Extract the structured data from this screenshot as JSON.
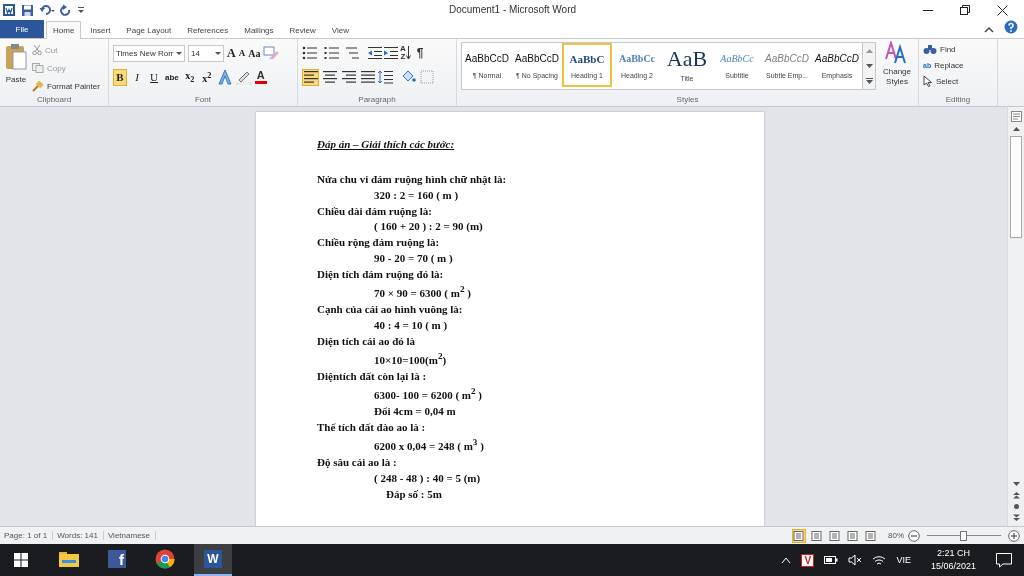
{
  "window": {
    "title": "Document1 - Microsoft Word"
  },
  "tabs": [
    {
      "label": "File",
      "kind": "file",
      "selected": false
    },
    {
      "label": "Home",
      "kind": "tab",
      "selected": true
    },
    {
      "label": "Insert",
      "kind": "tab",
      "selected": false
    },
    {
      "label": "Page Layout",
      "kind": "tab",
      "selected": false
    },
    {
      "label": "References",
      "kind": "tab",
      "selected": false
    },
    {
      "label": "Mailings",
      "kind": "tab",
      "selected": false
    },
    {
      "label": "Review",
      "kind": "tab",
      "selected": false
    },
    {
      "label": "View",
      "kind": "tab",
      "selected": false
    }
  ],
  "clipboard": {
    "paste": "Paste",
    "cut": "Cut",
    "copy": "Copy",
    "format_painter": "Format Painter",
    "group": "Clipboard"
  },
  "font": {
    "name": "Times New Rorr",
    "size": "14",
    "grow": "A",
    "shrink": "A",
    "case": "Aa",
    "group": "Font",
    "format_buttons": [
      {
        "label": "B",
        "kind": "bold",
        "selected": true
      },
      {
        "label": "I",
        "kind": "italic",
        "selected": false
      },
      {
        "label": "U",
        "kind": "underline",
        "selected": false
      },
      {
        "label": "abe",
        "kind": "strike",
        "selected": false
      },
      {
        "label": "x$_{2}$",
        "kind": "sub",
        "selected": false
      },
      {
        "label": "x$^{2}$",
        "kind": "sup",
        "selected": false
      }
    ],
    "color_letter": "A"
  },
  "paragraph": {
    "group": "Paragraph",
    "pilcrow": "¶",
    "sort_a": "A",
    "sort_z": "Z",
    "alignment": [
      {
        "selected": true
      },
      {
        "selected": false
      },
      {
        "selected": false
      },
      {
        "selected": false
      }
    ]
  },
  "styles": {
    "group": "Styles",
    "change": "Change Styles",
    "items": [
      {
        "preview": "AaBbCcD",
        "label": "¶ Normal",
        "kind": "normal",
        "selected": false
      },
      {
        "preview": "AaBbCcD",
        "label": "¶ No Spacing",
        "kind": "normal",
        "selected": false
      },
      {
        "preview": "AaBbC",
        "label": "Heading 1",
        "kind": "heading1",
        "selected": true
      },
      {
        "preview": "AaBbCc",
        "label": "Heading 2",
        "kind": "heading2",
        "selected": false
      },
      {
        "preview": "AaB",
        "label": "Title",
        "kind": "title",
        "selected": false
      },
      {
        "preview": "AaBbCc",
        "label": "Subtitle",
        "kind": "subtitle",
        "selected": false
      },
      {
        "preview": "AaBbCcD",
        "label": "Subtle Emp...",
        "kind": "subtle",
        "selected": false
      },
      {
        "preview": "AaBbCcD",
        "label": "Emphasis",
        "kind": "emphasis",
        "selected": false
      }
    ]
  },
  "editing": {
    "find": "Find",
    "replace": "Replace",
    "select": "Select",
    "group": "Editing",
    "replace_mark": "ab"
  },
  "document": {
    "heading": "Đáp án – Giải thích các bước:",
    "lines": [
      {
        "text": "Nửa chu vi đám ruộng hình chữ nhật là:",
        "kind": "label"
      },
      {
        "text": "320 : 2 = 160 ( m )",
        "kind": "formula"
      },
      {
        "text": "Chiều dài đám ruộng là:",
        "kind": "label"
      },
      {
        "text": "( 160 + 20 ) : 2 = 90 (m)",
        "kind": "formula"
      },
      {
        "text": "Chiều rộng đám ruộng là:",
        "kind": "label"
      },
      {
        "text": "90 - 20 = 70 ( m )",
        "kind": "formula"
      },
      {
        "text": "Diện tích đám ruộng đó là:",
        "kind": "label"
      },
      {
        "text": "70 × 90 = 6300 ( m$^{2}$ )",
        "kind": "formula"
      },
      {
        "text": "Cạnh của cái ao hình vuông là:",
        "kind": "label"
      },
      {
        "text": "40 : 4 = 10 ( m )",
        "kind": "formula"
      },
      {
        "text": "Diện tích cái ao đó là",
        "kind": "label"
      },
      {
        "text": "10×10=100(m$^{2}$)",
        "kind": "formula"
      },
      {
        "text": "Diệntích đất còn lại là :",
        "kind": "label"
      },
      {
        "text": "6300- 100 = 6200 ( m$^{2}$ )",
        "kind": "formula"
      },
      {
        "text": "Đổi 4cm = 0,04 m",
        "kind": "formula"
      },
      {
        "text": "Thể tích đất đào ao là :",
        "kind": "label"
      },
      {
        "text": "6200 x 0,04 = 248 ( m$^{3}$ )",
        "kind": "formula"
      },
      {
        "text": "Độ sâu cái ao là :",
        "kind": "label"
      },
      {
        "text": "( 248 - 48 ) : 40 = 5 (m)",
        "kind": "formula"
      },
      {
        "text": "Đáp số : 5m",
        "kind": "answer"
      }
    ]
  },
  "status_bar": {
    "page": "Page: 1 of 1",
    "words": "Words: 141",
    "language": "Vietnamese",
    "zoom": "80%",
    "zoom_level": {
      "level": 0.5
    },
    "views": [
      {
        "selected": true
      },
      {
        "selected": false
      },
      {
        "selected": false
      },
      {
        "selected": false
      },
      {
        "selected": false
      }
    ]
  },
  "taskbar": {
    "apps": [
      {
        "kind": "explorer",
        "selected": false
      },
      {
        "kind": "facebook",
        "letter": "f",
        "selected": false
      },
      {
        "kind": "chrome",
        "selected": false
      },
      {
        "kind": "word",
        "letter": "W",
        "selected": true
      }
    ],
    "tray": {
      "antivirus": "V",
      "language": "VIE",
      "time": "2:21 CH",
      "date": "15/06/2021"
    }
  }
}
